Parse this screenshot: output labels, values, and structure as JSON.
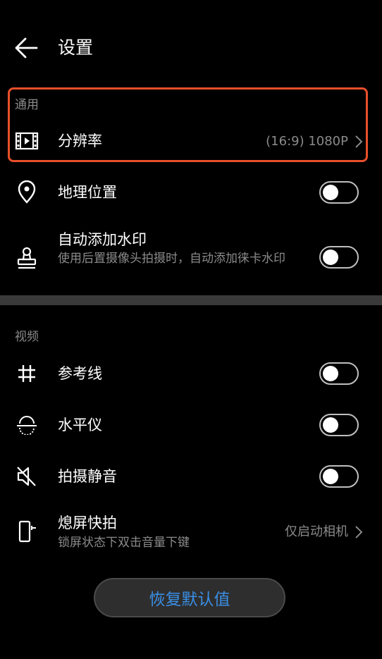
{
  "header": {
    "title": "设置",
    "back_icon": "arrow-left-icon"
  },
  "general": {
    "section_label": "通用",
    "resolution": {
      "label": "分辨率",
      "value": "(16:9) 1080P",
      "icon": "film-icon"
    },
    "location": {
      "label": "地理位置",
      "icon": "location-pin-icon",
      "enabled": false
    },
    "watermark": {
      "label": "自动添加水印",
      "description": "使用后置摄像头拍摄时，自动添加徕卡水印",
      "icon": "stamp-icon",
      "enabled": false
    }
  },
  "video": {
    "section_label": "视频",
    "grid": {
      "label": "参考线",
      "icon": "grid-icon",
      "enabled": false
    },
    "level": {
      "label": "水平仪",
      "icon": "level-icon",
      "enabled": false
    },
    "mute": {
      "label": "拍摄静音",
      "icon": "mute-icon",
      "enabled": false
    },
    "quick_snap": {
      "label": "熄屏快拍",
      "description": "锁屏状态下双击音量下键",
      "value": "仅启动相机",
      "icon": "phone-snap-icon"
    }
  },
  "reset_button": {
    "label": "恢复默认值"
  },
  "colors": {
    "accent": "#3a8fe6",
    "highlight": "#e8502a",
    "background": "#000000"
  }
}
